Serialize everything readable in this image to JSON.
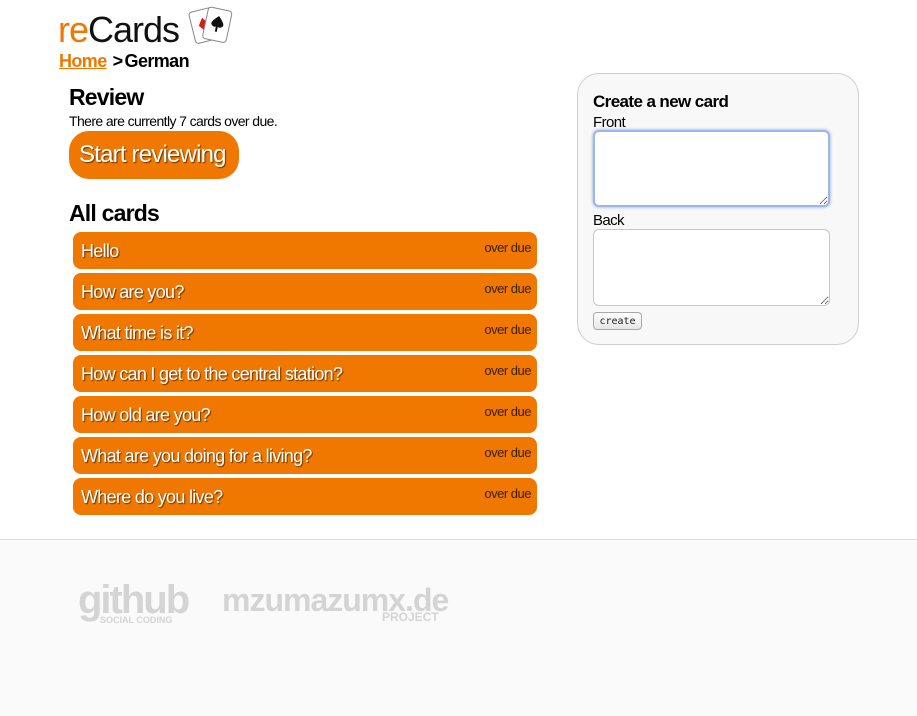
{
  "logo": {
    "prefix": "re",
    "suffix": "Cards",
    "icon": "playing-cards-icon"
  },
  "breadcrumb": {
    "home": "Home",
    "separator": ">",
    "current": "German"
  },
  "review": {
    "title": "Review",
    "text": "There are currently 7 cards over due.",
    "start_label": "Start reviewing"
  },
  "all_cards": {
    "title": "All cards",
    "items": [
      {
        "front": "Hello",
        "status": "over due"
      },
      {
        "front": "How are you?",
        "status": "over due"
      },
      {
        "front": "What time is it?",
        "status": "over due"
      },
      {
        "front": "How can I get to the central station?",
        "status": "over due"
      },
      {
        "front": "How old are you?",
        "status": "over due"
      },
      {
        "front": "What are you doing for a living?",
        "status": "over due"
      },
      {
        "front": "Where do you live?",
        "status": "over due"
      }
    ]
  },
  "create": {
    "title": "Create a new card",
    "front_label": "Front",
    "front_value": "",
    "back_label": "Back",
    "back_value": "",
    "button_label": "create"
  },
  "footer": {
    "github_main": "github",
    "github_sub": "SOCIAL CODING",
    "project_main": "mzumazumx.de",
    "project_sub": "PROJECT"
  },
  "colors": {
    "accent": "#f07800",
    "panel_bg": "#f8f8f8",
    "footer_bg": "#fafafa"
  }
}
